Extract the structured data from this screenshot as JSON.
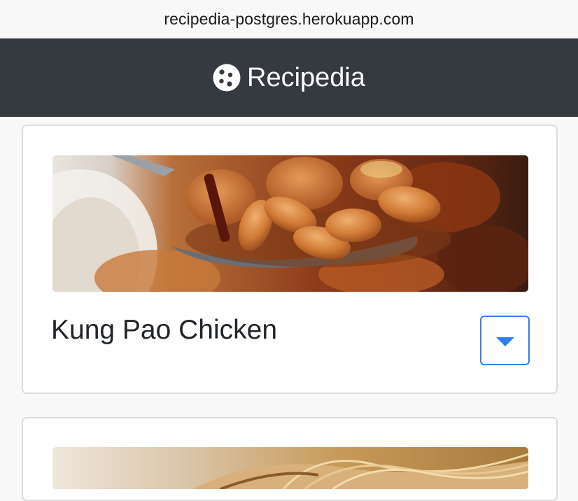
{
  "browser": {
    "url": "recipedia-postgres.herokuapp.com"
  },
  "navbar": {
    "brand_name": "Recipedia",
    "brand_icon": "cookie-icon"
  },
  "recipes": [
    {
      "title": "Kung Pao Chicken",
      "image": "kung-pao-chicken-photo",
      "toggle_icon": "caret-down-icon"
    },
    {
      "title": "",
      "image": "noodles-photo"
    }
  ],
  "colors": {
    "navbar_bg": "#343a40",
    "accent": "#2f80ed",
    "page_bg": "#f8f8f8"
  }
}
